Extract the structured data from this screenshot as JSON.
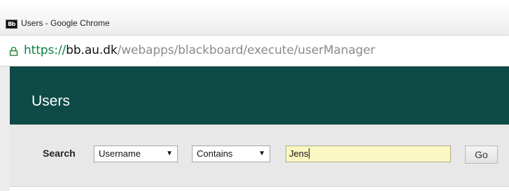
{
  "window": {
    "favicon_text": "Bb",
    "title": "Users - Google Chrome"
  },
  "address_bar": {
    "url_scheme": "https://",
    "url_host": "bb.au.dk",
    "url_path": "/webapps/blackboard/execute/userManager",
    "lock_icon": "lock-icon"
  },
  "page": {
    "title": "Users"
  },
  "search": {
    "label": "Search",
    "field_select": {
      "selected": "Username"
    },
    "operator_select": {
      "selected": "Contains"
    },
    "query_input": {
      "value": "Jens"
    },
    "go_label": "Go"
  },
  "colors": {
    "header_bg": "#0e4a46",
    "search_bar_bg": "#e8e8e8",
    "input_highlight": "#fbf7c2",
    "url_scheme": "#0b8043",
    "url_path": "#8a8a8a"
  }
}
